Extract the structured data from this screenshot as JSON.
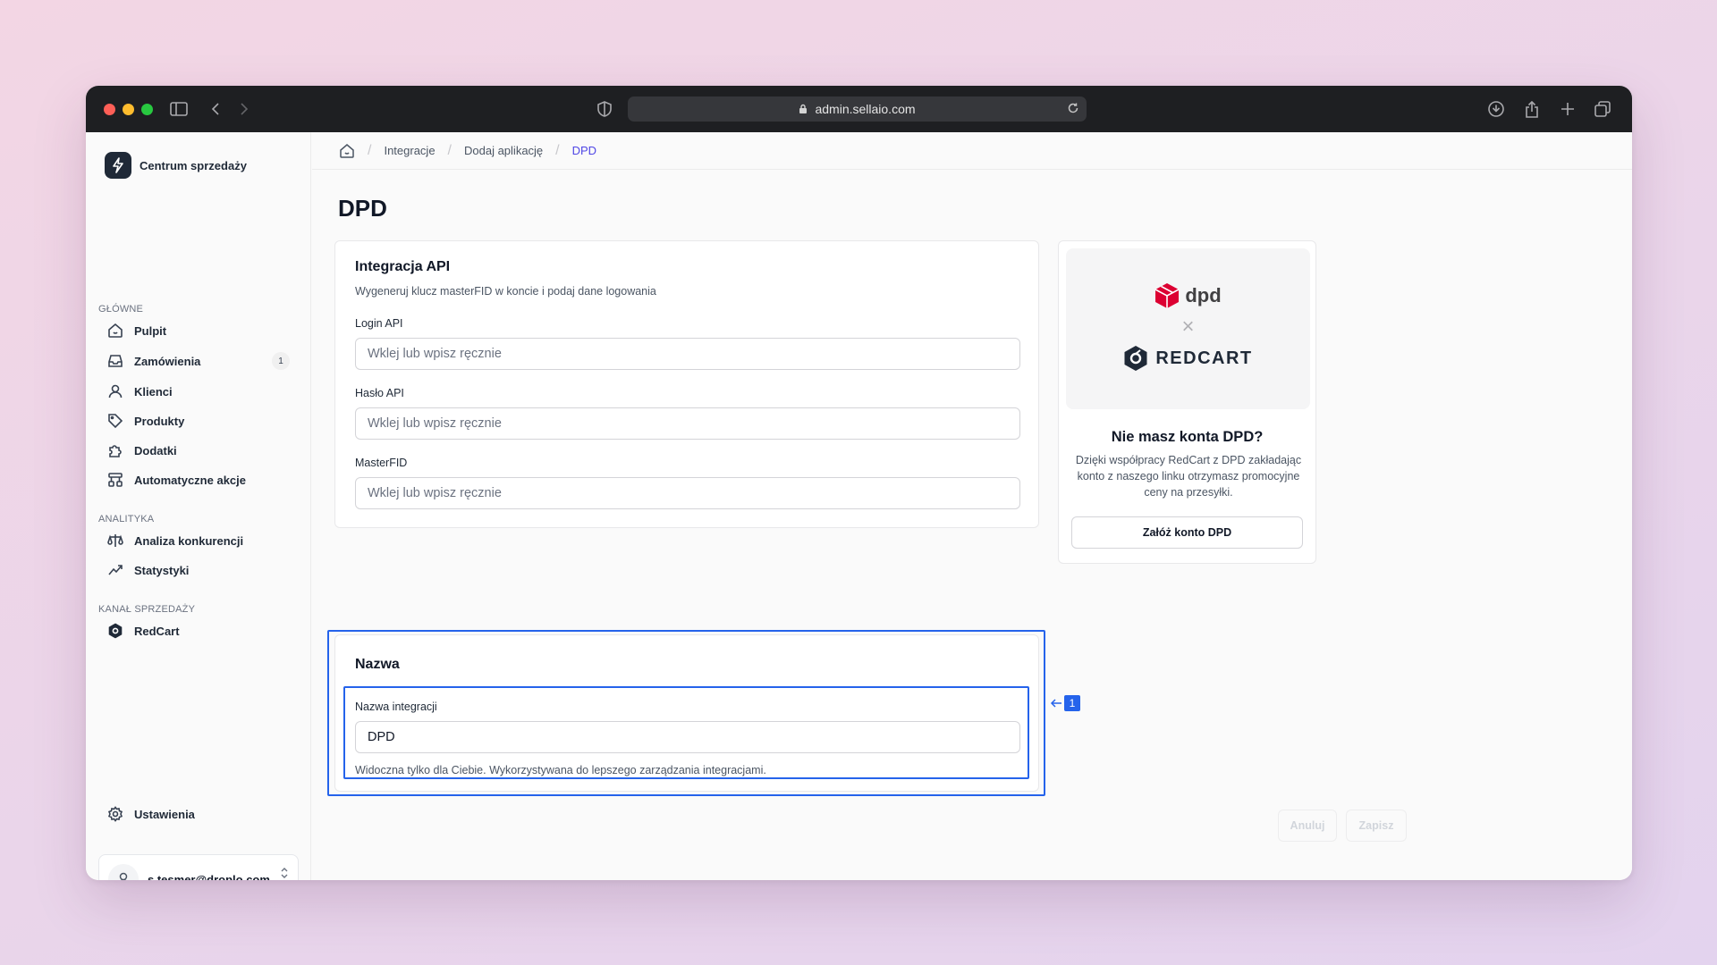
{
  "browser": {
    "url": "admin.sellaio.com"
  },
  "sidebar": {
    "brand": "Centrum sprzedaży",
    "sections": {
      "main": "GŁÓWNE",
      "analytics": "ANALITYKA",
      "channel": "KANAŁ SPRZEDAŻY"
    },
    "items": {
      "dashboard": "Pulpit",
      "orders": "Zamówienia",
      "orders_badge": "1",
      "clients": "Klienci",
      "products": "Produkty",
      "addons": "Dodatki",
      "automations": "Automatyczne akcje",
      "competition": "Analiza konkurencji",
      "stats": "Statystyki",
      "redcart": "RedCart",
      "settings": "Ustawienia"
    },
    "user_email": "s.tesmer@droplo.com"
  },
  "breadcrumb": {
    "items": [
      "Integracje",
      "Dodaj aplikację",
      "DPD"
    ]
  },
  "page": {
    "title": "DPD"
  },
  "api_card": {
    "title": "Integracja API",
    "subtitle": "Wygeneruj klucz masterFID w koncie i podaj dane logowania",
    "login_label": "Login API",
    "login_placeholder": "Wklej lub wpisz ręcznie",
    "password_label": "Hasło API",
    "password_placeholder": "Wklej lub wpisz ręcznie",
    "masterfid_label": "MasterFID",
    "masterfid_placeholder": "Wklej lub wpisz ręcznie"
  },
  "name_card": {
    "title": "Nazwa",
    "field_label": "Nazwa integracji",
    "field_value": "DPD",
    "hint": "Widoczna tylko dla Ciebie. Wykorzystywana do lepszego zarządzania integracjami."
  },
  "annotation": {
    "marker": "1"
  },
  "promo": {
    "logo_dpd": "dpd",
    "logo_x": "×",
    "logo_redcart": "REDCART",
    "title": "Nie masz konta DPD?",
    "text": "Dzięki współpracy RedCart z DPD zakładając konto z naszego linku otrzymasz promocyjne ceny na przesyłki.",
    "button": "Załóż konto DPD"
  },
  "actions": {
    "cancel": "Anuluj",
    "save": "Zapisz"
  },
  "colors": {
    "accent": "#2563eb",
    "breadcrumb_current": "#4f46e5",
    "dpd_red": "#dc0032"
  }
}
